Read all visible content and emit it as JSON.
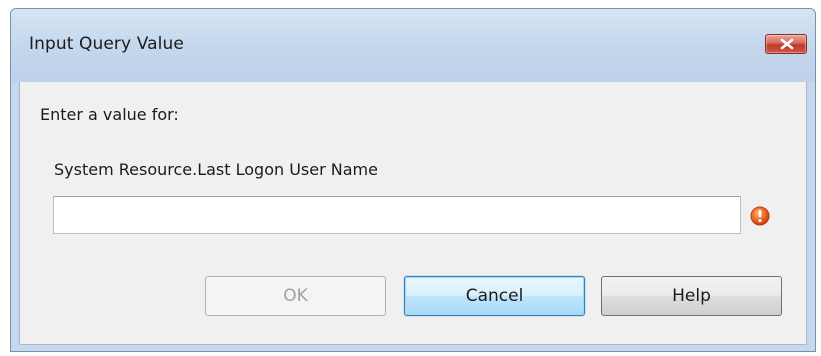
{
  "window": {
    "title": "Input Query Value",
    "close_icon": "close-icon"
  },
  "form": {
    "prompt": "Enter a value for:",
    "field_label": "System Resource.Last Logon User Name",
    "value": "",
    "error_icon": "error-icon",
    "error_color": "#e8501e"
  },
  "buttons": {
    "ok_label": "OK",
    "cancel_label": "Cancel",
    "help_label": "Help"
  }
}
